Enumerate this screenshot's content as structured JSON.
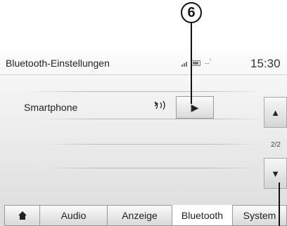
{
  "callout": {
    "number": "6"
  },
  "header": {
    "title": "Bluetooth-Einstellungen",
    "clock": "15:30",
    "status_icons": [
      "signal-icon",
      "battery-icon",
      "network-icon"
    ],
    "network_text": "--"
  },
  "list": {
    "items": [
      {
        "label": "Smartphone",
        "status_icon": "bluetooth-audio-icon",
        "action_icon": "play-arrow-icon"
      }
    ]
  },
  "scroll": {
    "up_icon": "▲",
    "down_icon": "▼",
    "page_indicator": "2/2"
  },
  "tabs": [
    {
      "label": "",
      "icon": "home-icon"
    },
    {
      "label": "Audio"
    },
    {
      "label": "Anzeige"
    },
    {
      "label": "Bluetooth",
      "active": true
    },
    {
      "label": "System"
    }
  ],
  "colors": {
    "accent": "#ffffff",
    "text": "#1a1a1a",
    "border": "#999999"
  }
}
